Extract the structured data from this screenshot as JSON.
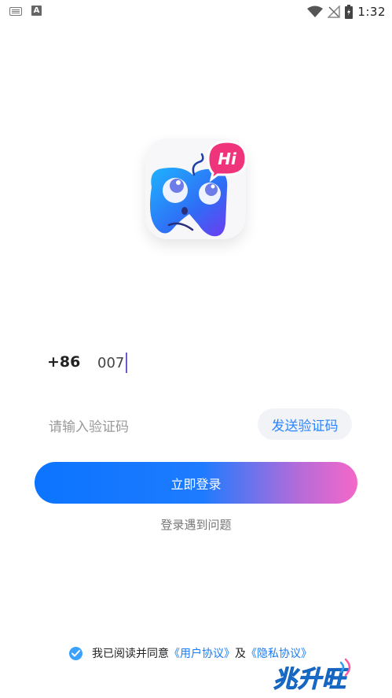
{
  "status_bar": {
    "time": "1:32",
    "notification_icons": [
      "keyboard-icon",
      "a-letter-icon"
    ],
    "system_icons": [
      "wifi-icon",
      "no-signal-icon",
      "battery-icon"
    ]
  },
  "logo": {
    "badge_text": "Hi",
    "colors": {
      "badge": "#f0347c",
      "character_start": "#1fb3ff",
      "character_end": "#6d3cf0"
    }
  },
  "phone": {
    "country_code": "+86",
    "value": "007"
  },
  "verification": {
    "placeholder": "请输入验证码",
    "send_button_label": "发送验证码"
  },
  "login": {
    "button_label": "立即登录",
    "problem_link": "登录遇到问题",
    "gradient": [
      "#0b74ff",
      "#f468c8"
    ]
  },
  "agreement": {
    "checked": true,
    "prefix": "我已阅读并同意",
    "user_agreement": "《用户协议》",
    "conjunction": "及",
    "privacy_policy": "《隐私协议》"
  },
  "watermark": {
    "text": "兆升旺"
  }
}
